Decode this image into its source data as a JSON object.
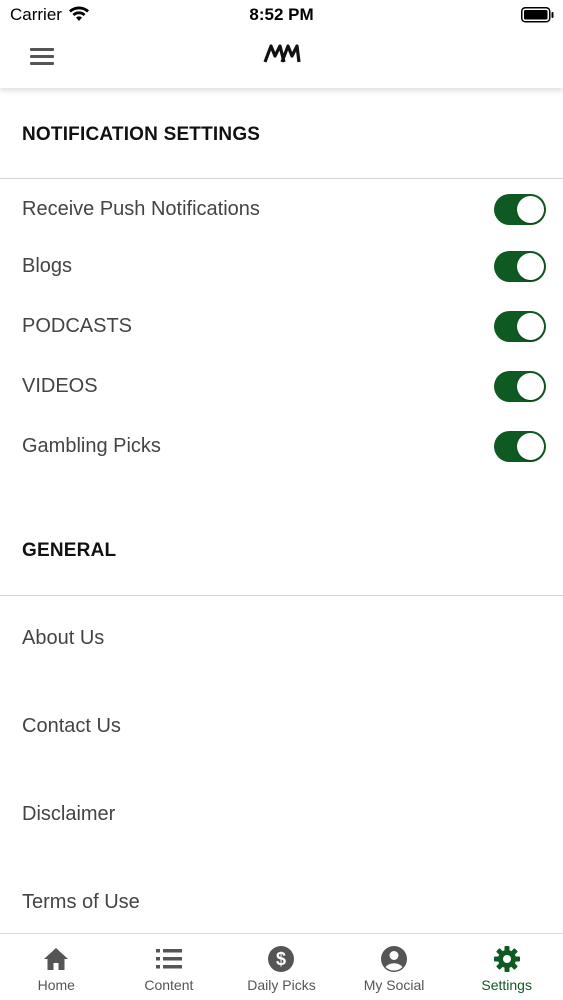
{
  "status_bar": {
    "carrier": "Carrier",
    "time": "8:52 PM"
  },
  "header": {
    "menu_icon": "hamburger-menu-icon",
    "logo": "brand-logo"
  },
  "notification_settings": {
    "title": "NOTIFICATION SETTINGS",
    "items": [
      {
        "label": "Receive Push Notifications",
        "enabled": true
      },
      {
        "label": "Blogs",
        "enabled": true
      },
      {
        "label": "PODCASTS",
        "enabled": true
      },
      {
        "label": "VIDEOS",
        "enabled": true
      },
      {
        "label": "Gambling Picks",
        "enabled": true
      }
    ]
  },
  "general": {
    "title": "GENERAL",
    "items": [
      {
        "label": "About Us"
      },
      {
        "label": "Contact Us"
      },
      {
        "label": "Disclaimer"
      },
      {
        "label": "Terms of Use"
      }
    ]
  },
  "tab_bar": {
    "tabs": [
      {
        "label": "Home",
        "icon": "home-icon",
        "active": false
      },
      {
        "label": "Content",
        "icon": "list-icon",
        "active": false
      },
      {
        "label": "Daily Picks",
        "icon": "dollar-icon",
        "active": false
      },
      {
        "label": "My Social",
        "icon": "person-icon",
        "active": false
      },
      {
        "label": "Settings",
        "icon": "gear-icon",
        "active": true
      }
    ]
  },
  "colors": {
    "accent": "#0f5a23",
    "inactive_tab": "#555555",
    "divider": "#d4d4d4"
  }
}
